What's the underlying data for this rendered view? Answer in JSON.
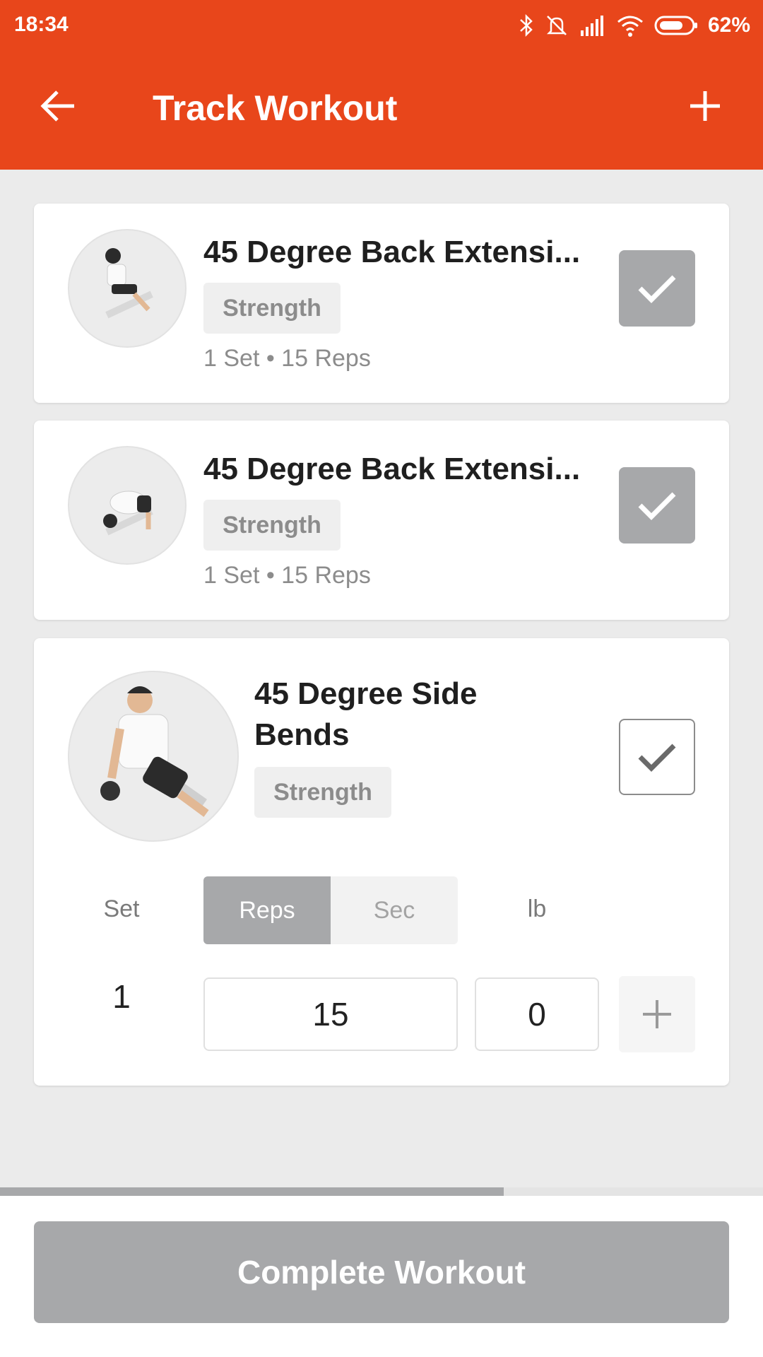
{
  "status_bar": {
    "time": "18:34",
    "battery": "62%"
  },
  "app_bar": {
    "title": "Track Workout"
  },
  "exercises": [
    {
      "name": "45 Degree Back Extensi...",
      "category": "Strength",
      "summary": "1 Set • 15 Reps",
      "completed": true
    },
    {
      "name": "45 Degree Back Extensi...",
      "category": "Strength",
      "summary": "1 Set • 15 Reps",
      "completed": true
    },
    {
      "name": "45 Degree Side Bends",
      "category": "Strength",
      "completed": false
    }
  ],
  "set_table": {
    "set_label": "Set",
    "reps_tab": "Reps",
    "sec_tab": "Sec",
    "unit_label": "lb",
    "rows": [
      {
        "set": "1",
        "reps": "15",
        "weight": "0"
      }
    ]
  },
  "progress": {
    "fraction": 0.66
  },
  "complete_button": {
    "label": "Complete Workout"
  },
  "colors": {
    "accent": "#e8461b",
    "disabled": "#a7a8aa"
  },
  "icons": [
    "back-arrow-icon",
    "plus-icon",
    "checkmark-icon",
    "bluetooth-icon",
    "silent-icon",
    "signal-icon",
    "wifi-icon",
    "battery-icon"
  ]
}
